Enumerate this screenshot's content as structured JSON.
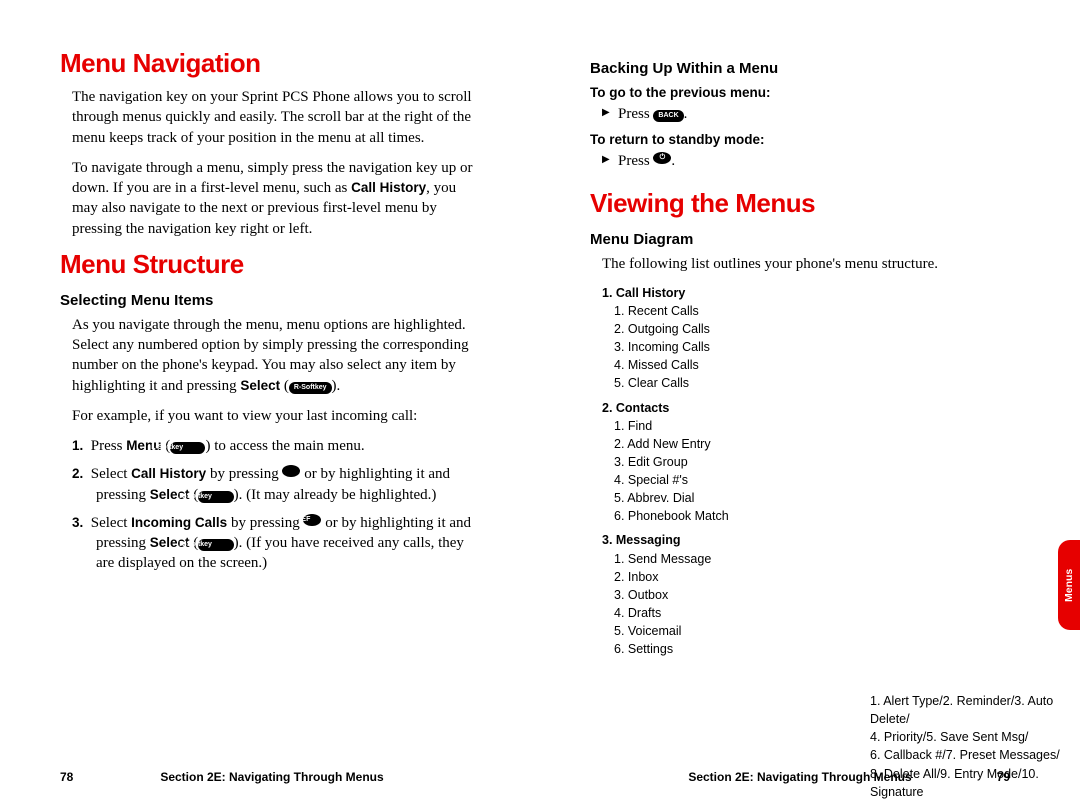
{
  "leftPage": {
    "h1a": "Menu Navigation",
    "p1": "The navigation key on your Sprint PCS Phone allows you to scroll through menus quickly and easily. The scroll bar at the right of the menu keeps track of your position in the menu at all times.",
    "p2a": "To navigate through a menu, simply press the navigation key up or down. If you are in a first-level menu, such as ",
    "p2b": "Call History",
    "p2c": ", you may also navigate to the next or previous first-level menu by pressing the navigation key right or left.",
    "h1b": "Menu Structure",
    "h2a": "Selecting Menu Items",
    "p3a": "As you navigate through the menu, menu options are highlighted. Select any numbered option by simply pressing the corresponding number on the phone's keypad. You may also select any item by highlighting it and pressing ",
    "p3b": "Select",
    "p3c": " (",
    "p3key": "R-Softkey",
    "p3d": ").",
    "p4": "For example, if you want to view your last incoming call:",
    "step1a": "Press ",
    "step1b": "Menu",
    "step1c": " (",
    "step1key": "L-Softkey",
    "step1d": ") to access the main menu.",
    "step2a": "Select ",
    "step2b": "Call History",
    "step2c": " by pressing ",
    "step2key1": "1",
    "step2d": " or by highlighting it and pressing ",
    "step2e": "Select",
    "step2f": " (",
    "step2key2": "R-Softkey",
    "step2g": "). (It may already be highlighted.)",
    "step3a": "Select ",
    "step3b": "Incoming Calls",
    "step3c": " by pressing ",
    "step3key1": "3 DEF",
    "step3d": " or by highlighting it and pressing ",
    "step3e": "Select",
    "step3f": " (",
    "step3key2": "R-Softkey",
    "step3g": "). (If you have received any calls, they are displayed on the screen.)",
    "pageNum": "78",
    "footerTitle": "Section 2E: Navigating Through Menus"
  },
  "rightPage": {
    "h2a": "Backing Up Within a Menu",
    "h3a": "To go to the previous menu:",
    "b1": "Press ",
    "b1key": "BACK",
    "b1end": ".",
    "h3b": "To return to standby mode:",
    "b2": "Press ",
    "b2end": ".",
    "h1": "Viewing the Menus",
    "h2b": "Menu Diagram",
    "p1": "The following list outlines your phone's menu structure.",
    "menu": {
      "cat1": "1. Call History",
      "c1": [
        "1. Recent Calls",
        "2. Outgoing Calls",
        "3. Incoming Calls",
        "4. Missed Calls",
        "5. Clear Calls"
      ],
      "cat2": "2. Contacts",
      "c2": [
        "1. Find",
        "2. Add New Entry",
        "3. Edit Group",
        "4. Special #'s",
        "5. Abbrev. Dial",
        "6. Phonebook Match"
      ],
      "cat3": "3. Messaging",
      "c3": [
        "1. Send Message",
        "2. Inbox",
        "3. Outbox",
        "4. Drafts",
        "5. Voicemail",
        "6. Settings"
      ]
    },
    "settingsSub": [
      "1. Alert Type/2. Reminder/3. Auto Delete/",
      "4. Priority/5. Save Sent Msg/",
      "6. Callback #/7. Preset Messages/",
      "8. Delete All/9. Entry Mode/10. Signature"
    ],
    "tab": "Menus",
    "pageNum": "79",
    "footerTitle": "Section 2E: Navigating Through Menus"
  }
}
